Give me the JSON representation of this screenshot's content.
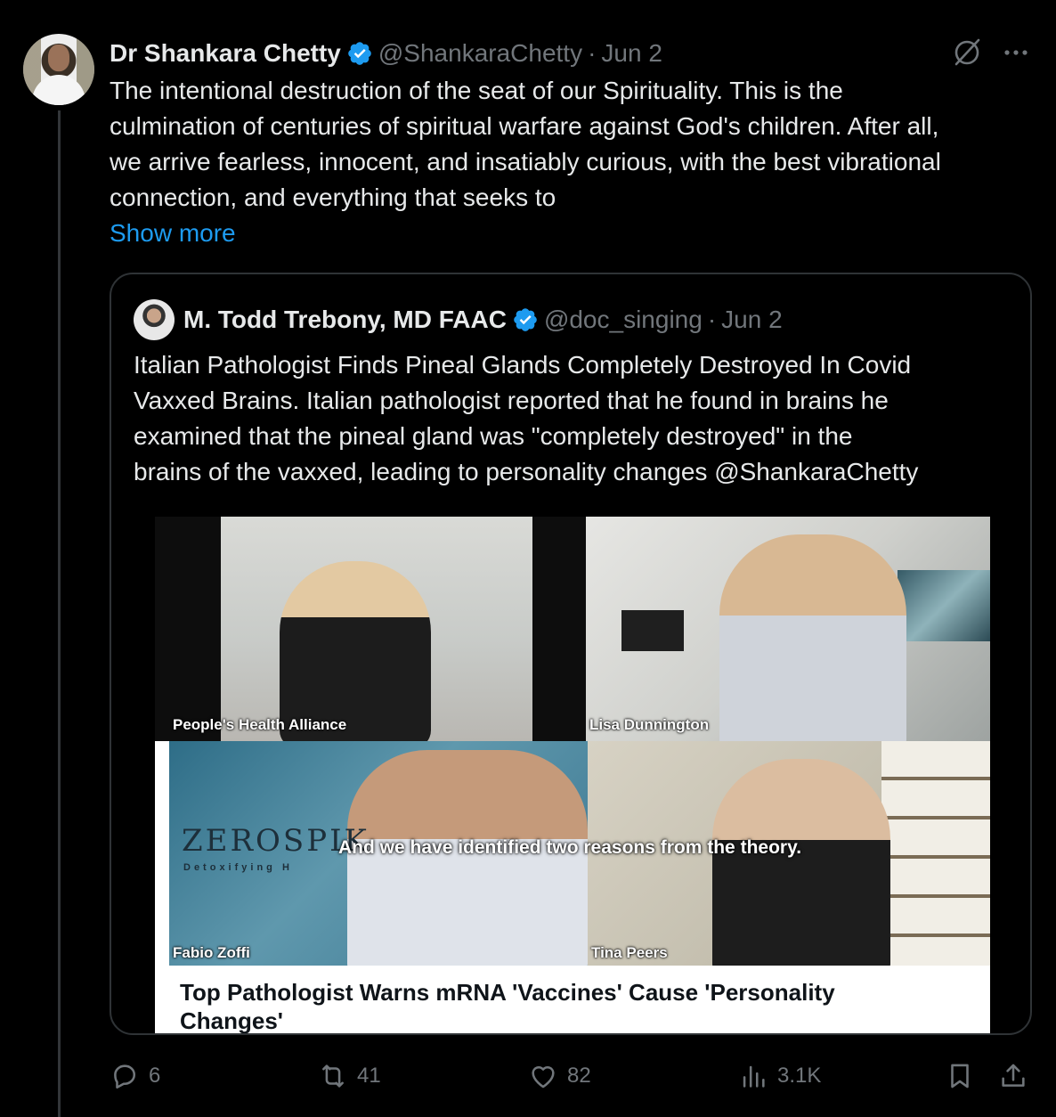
{
  "tweet": {
    "author_name": "Dr Shankara Chetty",
    "handle": "@ShankaraChetty",
    "separator": "·",
    "date": "Jun 2",
    "text_lines": [
      "The intentional destruction of the seat of our Spirituality. This is the",
      "culmination of centuries of spiritual warfare against God's children. After all,",
      "we arrive fearless, innocent, and insatiably curious, with the best vibrational",
      "connection, and everything that seeks to"
    ],
    "show_more": "Show more"
  },
  "quote": {
    "author_name": "M. Todd Trebony, MD FAAC",
    "handle": "@doc_singing",
    "separator": "·",
    "date": "Jun 2",
    "text_lines": [
      "Italian Pathologist Finds Pineal Glands Completely Destroyed In Covid",
      "Vaxxed Brains.   Italian pathologist reported that he found in brains he",
      "examined that the pineal gland was \"completely destroyed\" in the",
      "brains of the vaxxed, leading to personality changes @ShankaraChetty"
    ],
    "media": {
      "labels": {
        "top_left": "People's Health Alliance",
        "top_right": "Lisa Dunnington",
        "bottom_left": "Fabio Zoffi",
        "bottom_right": "Tina Peers"
      },
      "logo": "ZEROSPIK",
      "logo_sub": "Detoxifying H",
      "caption": "And we have identified two reasons from the theory.",
      "headline_lines": [
        "Top Pathologist Warns mRNA 'Vaccines' Cause 'Personality",
        "Changes'"
      ]
    }
  },
  "actions": {
    "replies": "6",
    "reposts": "41",
    "likes": "82",
    "views": "3.1K"
  },
  "colors": {
    "background": "#000000",
    "text": "#e7e9ea",
    "muted": "#71767b",
    "accent": "#1d9bf0",
    "border": "#2f3336"
  },
  "icons": [
    "verified-badge-icon",
    "grok-icon",
    "more-icon",
    "reply-icon",
    "repost-icon",
    "like-icon",
    "views-icon",
    "bookmark-icon",
    "share-icon"
  ]
}
